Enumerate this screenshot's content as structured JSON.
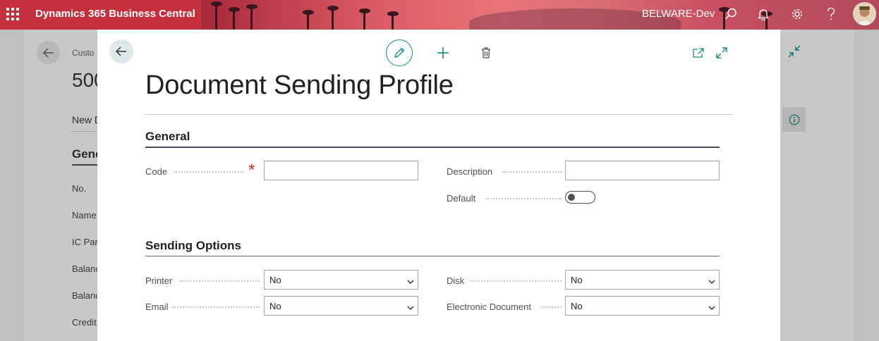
{
  "topbar": {
    "app_name": "Dynamics 365 Business Central",
    "environment": "BELWARE-Dev"
  },
  "background_page": {
    "breadcrumb": "Custo",
    "record_title": "500",
    "action": "New D",
    "section": "Gene",
    "fields": [
      "No.",
      "Name",
      "IC Par",
      "Balanc",
      "Balanc",
      "Credit"
    ]
  },
  "dialog": {
    "title": "Document Sending Profile",
    "sections": {
      "general": {
        "title": "General",
        "code_label": "Code",
        "code_value": "",
        "description_label": "Description",
        "description_value": "",
        "default_label": "Default",
        "default_on": false
      },
      "sending_options": {
        "title": "Sending Options",
        "printer_label": "Printer",
        "printer_value": "No",
        "email_label": "Email",
        "email_value": "No",
        "disk_label": "Disk",
        "disk_value": "No",
        "edoc_label": "Electronic Document",
        "edoc_value": "No"
      }
    }
  },
  "icons": {
    "app_launcher": "waffle-icon",
    "search": "search-icon",
    "notifications": "bell-icon",
    "settings": "gear-icon",
    "help": "help-icon",
    "back": "arrow-left-icon",
    "edit": "pencil-icon",
    "new": "plus-icon",
    "delete": "trash-icon",
    "open_new_window": "open-in-new-window-icon",
    "expand": "expand-icon",
    "collapse": "collapse-icon",
    "info": "info-icon"
  },
  "colors": {
    "brand_bar": "#c4303e",
    "accent": "#138a8a",
    "required": "#d42b2b"
  }
}
